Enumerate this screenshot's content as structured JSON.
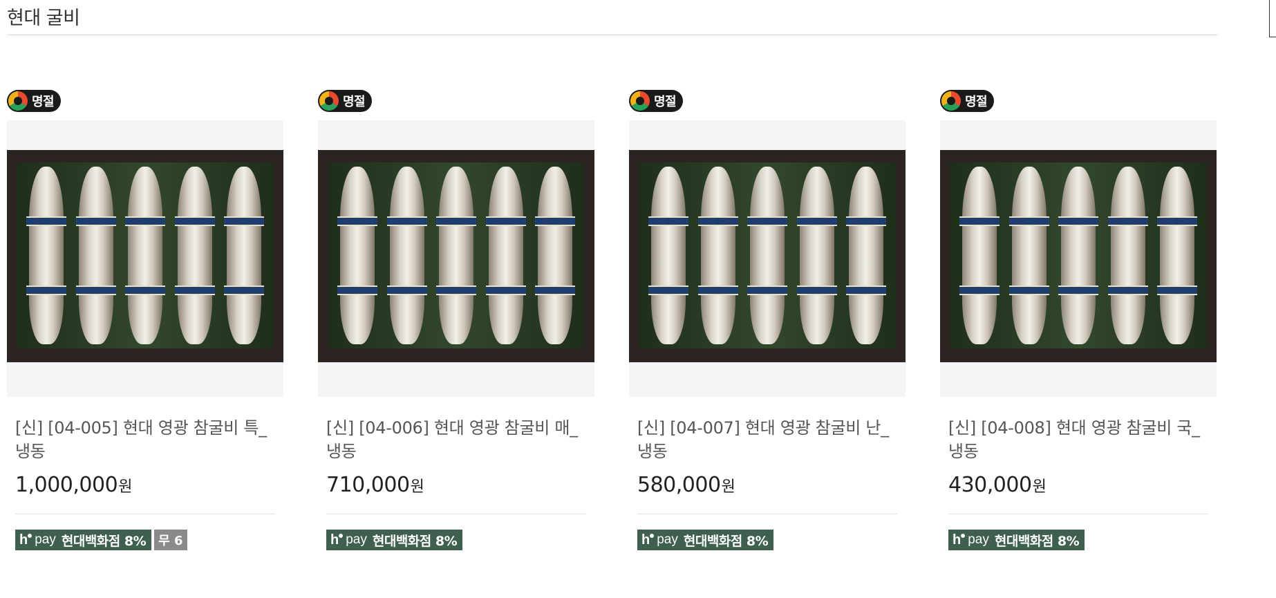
{
  "section": {
    "title": "현대 굴비"
  },
  "products": [
    {
      "badge": "명절",
      "name": "[신] [04-005] 현대 영광 참굴비 특_냉동",
      "price": "1,000,000",
      "currency": "원",
      "pay_brand": "pay",
      "pay_benefit": "현대백화점 8%",
      "extra_tag": "무 6"
    },
    {
      "badge": "명절",
      "name": "[신] [04-006] 현대 영광 참굴비 매_냉동",
      "price": "710,000",
      "currency": "원",
      "pay_brand": "pay",
      "pay_benefit": "현대백화점 8%",
      "extra_tag": ""
    },
    {
      "badge": "명절",
      "name": "[신] [04-007] 현대 영광 참굴비 난_냉동",
      "price": "580,000",
      "currency": "원",
      "pay_brand": "pay",
      "pay_benefit": "현대백화점 8%",
      "extra_tag": ""
    },
    {
      "badge": "명절",
      "name": "[신] [04-008] 현대 영광 참굴비 국_냉동",
      "price": "430,000",
      "currency": "원",
      "pay_brand": "pay",
      "pay_benefit": "현대백화점 8%",
      "extra_tag": ""
    }
  ],
  "icons": {
    "badge_icon": "holiday-logo-icon",
    "pay_icon": "h-pay-icon"
  },
  "colors": {
    "pay_tag": "#3f5f4f",
    "badge_bg": "#1a1a1a",
    "extra_tag": "#8a8a8a"
  }
}
